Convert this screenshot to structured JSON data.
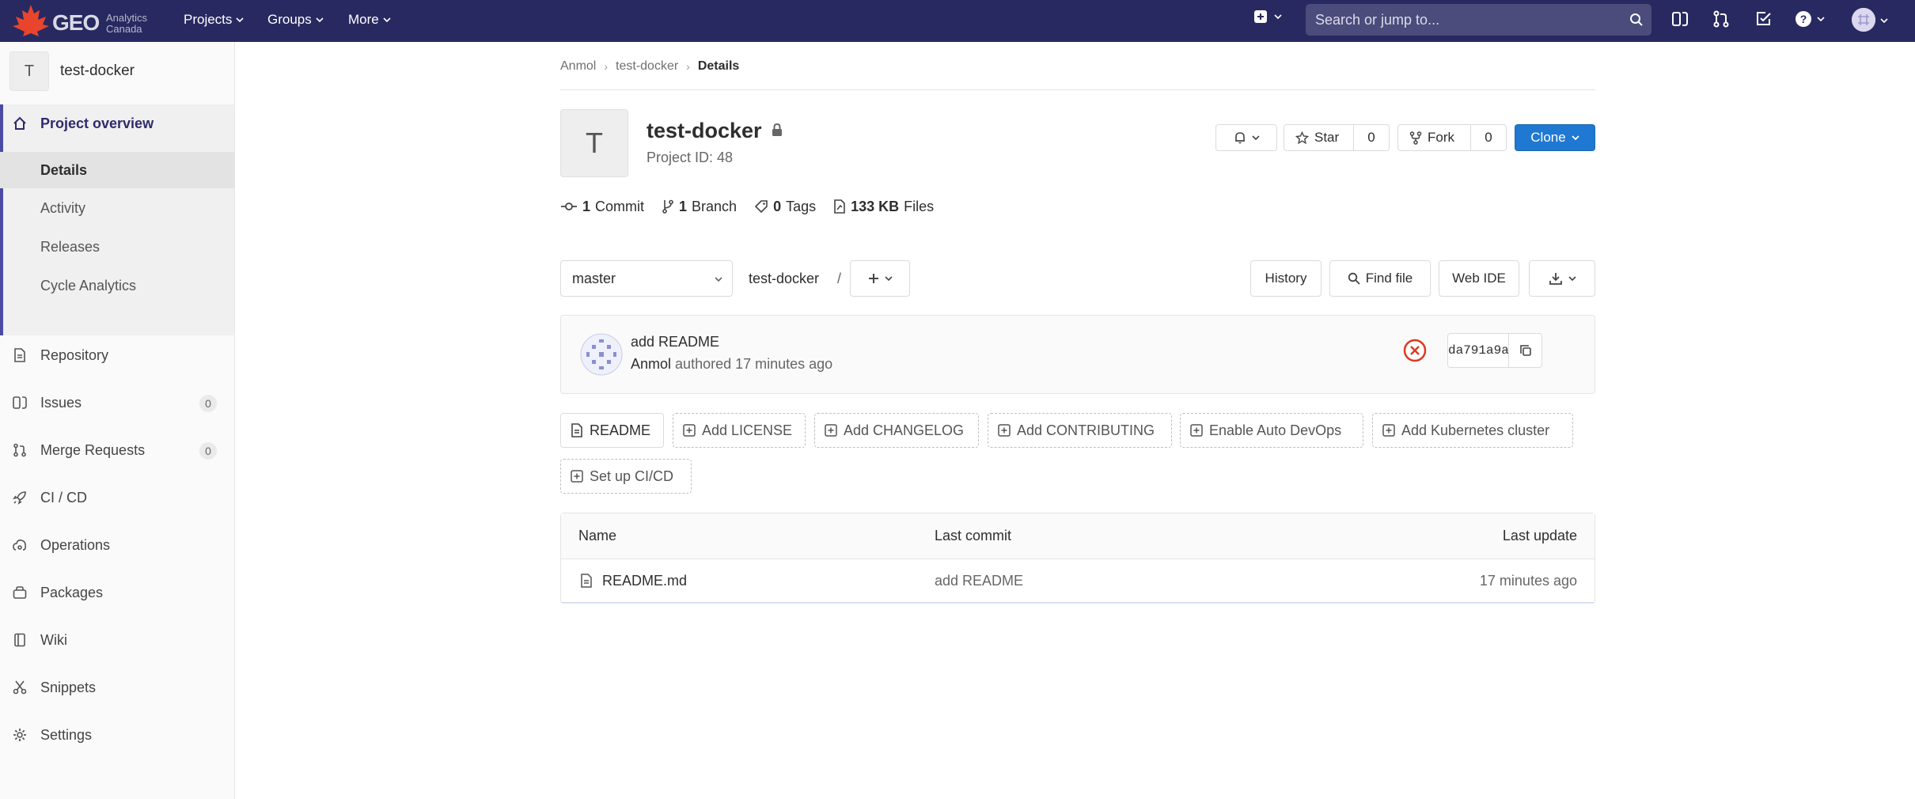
{
  "navbar": {
    "logo_text": "GEO",
    "logo_sub_line1": "Analytics",
    "logo_sub_line2": "Canada",
    "projects": "Projects",
    "groups": "Groups",
    "more": "More",
    "search_placeholder": "Search or jump to..."
  },
  "sidebar": {
    "project_letter": "T",
    "project_name": "test-docker",
    "overview": "Project overview",
    "sub_items": [
      "Details",
      "Activity",
      "Releases",
      "Cycle Analytics"
    ],
    "repository": "Repository",
    "issues": "Issues",
    "issues_count": "0",
    "merge_requests": "Merge Requests",
    "merge_requests_count": "0",
    "cicd": "CI / CD",
    "operations": "Operations",
    "packages": "Packages",
    "wiki": "Wiki",
    "snippets": "Snippets",
    "settings": "Settings"
  },
  "breadcrumb": [
    "Anmol",
    "test-docker",
    "Details"
  ],
  "project": {
    "letter": "T",
    "title": "test-docker",
    "project_id": "Project ID: 48",
    "star_label": "Star",
    "star_count": "0",
    "fork_label": "Fork",
    "fork_count": "0",
    "clone_label": "Clone"
  },
  "stats": {
    "commits_num": "1",
    "commits_label": "Commit",
    "branches_num": "1",
    "branches_label": "Branch",
    "tags_num": "0",
    "tags_label": "Tags",
    "files_num": "133 KB",
    "files_label": "Files"
  },
  "repo_nav": {
    "branch": "master",
    "path": "test-docker",
    "separator": "/",
    "history": "History",
    "find_file": "Find file",
    "web_ide": "Web IDE"
  },
  "last_commit": {
    "title": "add README",
    "author": "Anmol",
    "authored": "authored 17 minutes ago",
    "sha": "da791a9a",
    "pipeline_status": "failed"
  },
  "quick_actions": {
    "readme": "README",
    "add_license": "Add LICENSE",
    "add_changelog": "Add CHANGELOG",
    "add_contributing": "Add CONTRIBUTING",
    "enable_auto_devops": "Enable Auto DevOps",
    "add_kubernetes": "Add Kubernetes cluster",
    "setup_cicd": "Set up CI/CD"
  },
  "tree": {
    "headers": [
      "Name",
      "Last commit",
      "Last update"
    ],
    "rows": [
      {
        "name": "README.md",
        "last_commit": "add README",
        "last_update": "17 minutes ago"
      }
    ]
  },
  "colors": {
    "navbar": "#292961",
    "accent": "#1f78d1",
    "sidebar_active": "#4b4ba3",
    "pipeline_failed": "#db3b21"
  }
}
